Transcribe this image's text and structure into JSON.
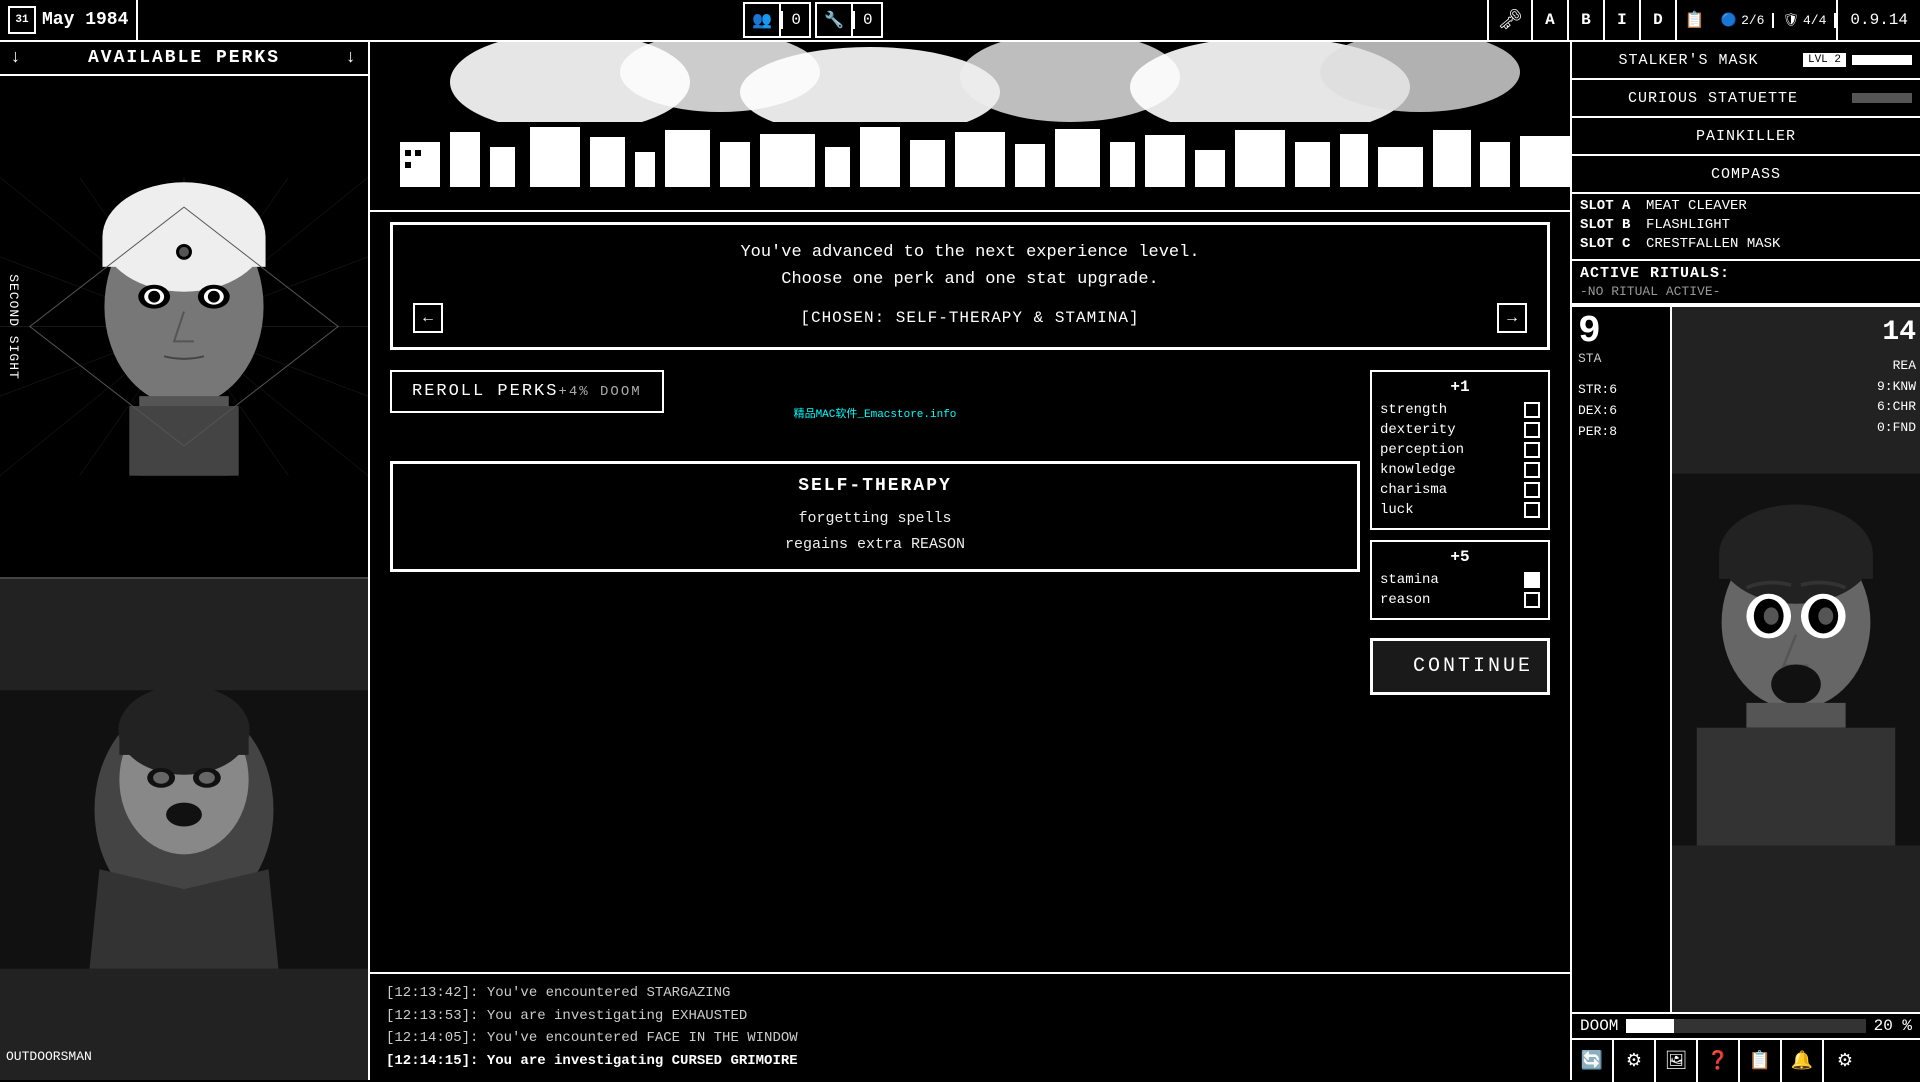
{
  "topbar": {
    "date": "May 1984",
    "day": "31",
    "version": "0.9.14",
    "resources": [
      {
        "icon": "👥",
        "count": "0"
      },
      {
        "icon": "🔧",
        "count": "0"
      }
    ],
    "letters": [
      "A",
      "B",
      "I",
      "D",
      "📋"
    ]
  },
  "leftPanel": {
    "header": "AVAILABLE PERKS",
    "label_top": "SECOND SIGHT",
    "label_bottom": "OUTDOORSMAN"
  },
  "dialog": {
    "message_line1": "You've advanced to the next experience level.",
    "message_line2": "Choose one perk and one stat upgrade.",
    "chosen": "[CHOSEN: SELF-THERAPY & STAMINA]"
  },
  "perks": {
    "reroll_label": "REROLL PERKS",
    "reroll_cost": "+4% DOOM",
    "watermark": "精品MAC软件_Emacstore.info",
    "selected_name": "SELF-THERAPY",
    "selected_desc_line1": "forgetting spells",
    "selected_desc_line2": "regains extra REASON"
  },
  "stats_plus1": {
    "header": "+1",
    "stats": [
      {
        "name": "strength",
        "selected": false
      },
      {
        "name": "dexterity",
        "selected": false
      },
      {
        "name": "perception",
        "selected": false
      },
      {
        "name": "knowledge",
        "selected": false
      },
      {
        "name": "charisma",
        "selected": false
      },
      {
        "name": "luck",
        "selected": false
      }
    ]
  },
  "stats_plus5": {
    "header": "+5",
    "stats": [
      {
        "name": "stamina",
        "selected": true
      },
      {
        "name": "reason",
        "selected": false
      }
    ]
  },
  "continue_label": "CONTINUE",
  "log": [
    {
      "text": "[12:13:42]: You've encountered STARGAZING",
      "bold": false
    },
    {
      "text": "[12:13:53]: You are investigating EXHAUSTED",
      "bold": false
    },
    {
      "text": "[12:14:05]: You've encountered FACE IN THE WINDOW",
      "bold": false
    },
    {
      "text": "[12:14:15]: You are investigating CURSED GRIMOIRE",
      "bold": true
    }
  ],
  "inventory": [
    {
      "name": "STALKER'S MASK",
      "badge": "LVL 2",
      "has_bar": true
    },
    {
      "name": "CURIOUS STATUETTE",
      "badge": "",
      "has_bar": false
    },
    {
      "name": "PAINKILLER",
      "badge": "",
      "has_bar": false
    },
    {
      "name": "COMPASS",
      "badge": "",
      "has_bar": false
    }
  ],
  "slots": [
    {
      "label": "SLOT A",
      "item": "MEAT CLEAVER"
    },
    {
      "label": "SLOT B",
      "item": "FLASHLIGHT"
    },
    {
      "label": "SLOT C",
      "item": "CRESTFALLEN MASK"
    }
  ],
  "rituals": {
    "title": "ACTIVE RITUALS:",
    "value": "-NO RITUAL ACTIVE-"
  },
  "character_stats": {
    "sta": "9",
    "sta_label": "STA",
    "rea": "14",
    "rea_label": "REA",
    "str": "STR:6",
    "dex": "DEX:6",
    "per": "PER:8",
    "knw": "9:KNW",
    "chr": "6:CHR",
    "fnd": "0:FND",
    "doom_label": "DOOM",
    "doom_pct": "20 %"
  },
  "health_indicators": {
    "health": "2/6",
    "armor": "4/4"
  },
  "bottom_icons": [
    "🔄",
    "⚙",
    "🖼",
    "❓",
    "📋",
    "🔔",
    "⚙"
  ]
}
